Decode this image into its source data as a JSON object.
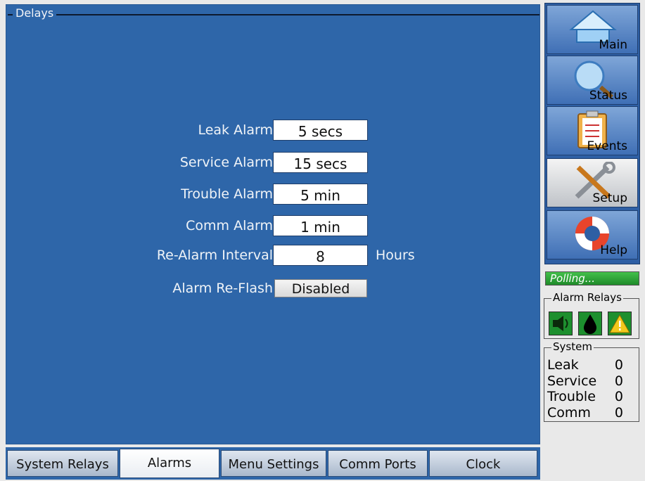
{
  "group_title": "Delays",
  "settings": [
    {
      "label": "Leak Alarm",
      "value": "5 secs"
    },
    {
      "label": "Service Alarm",
      "value": "15 secs"
    },
    {
      "label": "Trouble Alarm",
      "value": "5 min"
    },
    {
      "label": "Comm Alarm",
      "value": "1 min"
    },
    {
      "label": "Re-Alarm Interval",
      "value": "8",
      "unit": "Hours"
    },
    {
      "label": "Alarm Re-Flash",
      "value": "Disabled"
    }
  ],
  "tabs": [
    {
      "label": "System Relays"
    },
    {
      "label": "Alarms",
      "active": true
    },
    {
      "label": "Menu Settings"
    },
    {
      "label": "Comm Ports"
    },
    {
      "label": "Clock"
    }
  ],
  "nav": [
    {
      "label": "Main",
      "icon": "house-icon"
    },
    {
      "label": "Status",
      "icon": "magnifier-icon"
    },
    {
      "label": "Events",
      "icon": "clipboard-icon"
    },
    {
      "label": "Setup",
      "icon": "tools-icon",
      "active": true
    },
    {
      "label": "Help",
      "icon": "lifebuoy-icon"
    }
  ],
  "status": {
    "polling": "Polling..."
  },
  "alarm_relays": {
    "title": "Alarm Relays",
    "icons": [
      "speaker-icon",
      "drop-icon",
      "warning-icon"
    ]
  },
  "system": {
    "title": "System",
    "rows": [
      {
        "label": "Leak",
        "value": "0"
      },
      {
        "label": "Service",
        "value": "0"
      },
      {
        "label": "Trouble",
        "value": "0"
      },
      {
        "label": "Comm",
        "value": "0"
      }
    ]
  },
  "colors": {
    "panel_blue": "#2e66a9",
    "relay_green": "#1d8f2e",
    "warning_yellow": "#f2c81c"
  }
}
